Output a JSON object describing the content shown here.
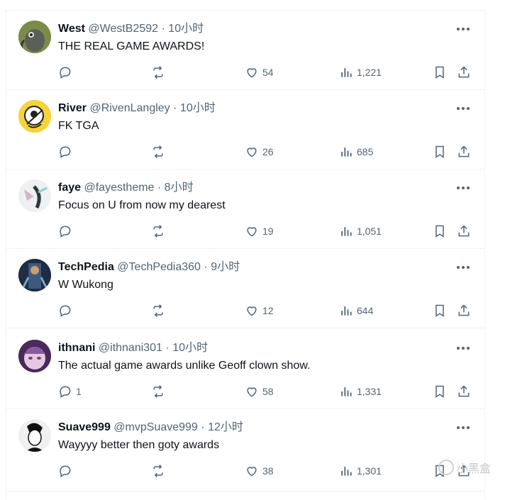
{
  "tweets": [
    {
      "name": "West",
      "handle": "@WestB2592",
      "dot": "·",
      "time": "10小时",
      "text": "THE REAL GAME AWARDS!",
      "reply_count": "",
      "like_count": "54",
      "view_count": "1,221",
      "avatar_color": "#5b6a3a"
    },
    {
      "name": "River",
      "handle": "@RivenLangley",
      "dot": "·",
      "time": "10小时",
      "text": "FK TGA",
      "reply_count": "",
      "like_count": "26",
      "view_count": "685",
      "avatar_color": "#f2d23c"
    },
    {
      "name": "faye",
      "handle": "@fayestheme",
      "dot": "·",
      "time": "8小时",
      "text": "Focus on U from now my dearest",
      "reply_count": "",
      "like_count": "19",
      "view_count": "1,051",
      "avatar_color": "#e9ecef"
    },
    {
      "name": "TechPedia",
      "handle": "@TechPedia360",
      "dot": "·",
      "time": "9小时",
      "text": "W Wukong",
      "reply_count": "",
      "like_count": "12",
      "view_count": "644",
      "avatar_color": "#2a3d5c"
    },
    {
      "name": "ithnani",
      "handle": "@ithnani301",
      "dot": "·",
      "time": "10小时",
      "text": "The actual game awards unlike Geoff clown show.",
      "reply_count": "1",
      "like_count": "58",
      "view_count": "1,331",
      "avatar_color": "#6a3f7a"
    },
    {
      "name": "Suave999",
      "handle": "@mvpSuave999",
      "dot": "·",
      "time": "12小时",
      "text": "Wayyyy better then goty awards",
      "reply_count": "",
      "like_count": "38",
      "view_count": "1,301",
      "avatar_color": "#d9d9d9"
    }
  ],
  "watermark": {
    "text": "小黑盒"
  },
  "icons": {
    "reply": "reply-icon",
    "retweet": "retweet-icon",
    "like": "heart-icon",
    "views": "views-icon",
    "bookmark": "bookmark-icon",
    "share": "share-icon",
    "more": "more-icon"
  },
  "colors": {
    "text": "#0f1419",
    "secondary": "#536471",
    "divider": "#eff3f4"
  }
}
